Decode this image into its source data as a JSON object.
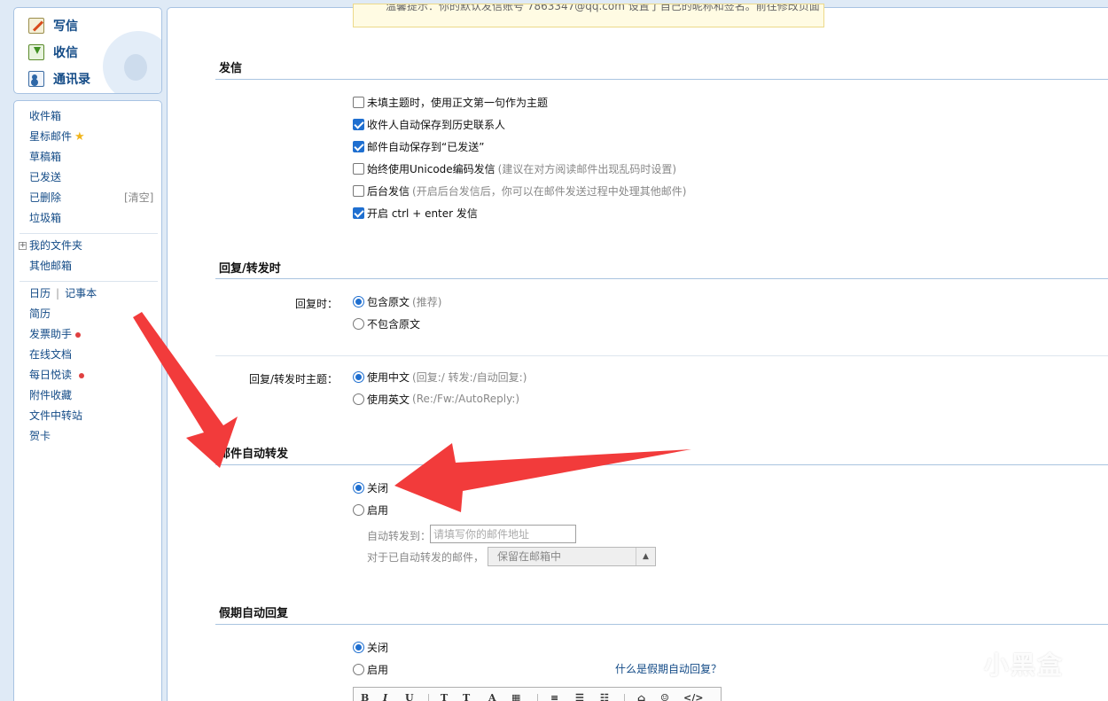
{
  "sidebar": {
    "top": [
      {
        "label": "写信",
        "icon": "compose-icon"
      },
      {
        "label": "收信",
        "icon": "inbox-download-icon"
      },
      {
        "label": "通讯录",
        "icon": "contacts-icon"
      }
    ],
    "folders": [
      "收件箱",
      "星标邮件",
      "草稿箱",
      "已发送",
      "已删除",
      "垃圾箱"
    ],
    "clear_label": "[清空]",
    "my_folders": "我的文件夹",
    "other_mailbox": "其他邮箱",
    "calendar": "日历",
    "notebook": "记事本",
    "tools": [
      "简历",
      "发票助手",
      "在线文档",
      "每日悦读",
      "附件收藏",
      "文件中转站",
      "贺卡"
    ]
  },
  "notice": "温馨提示：你的默认发信账号 7863347@qq.com 设置了自己的昵称和签名。前往修改页面",
  "send": {
    "title": "发信",
    "options": [
      {
        "label": "未填主题时，使用正文第一句作为主题",
        "hint": "",
        "checked": false
      },
      {
        "label": "收件人自动保存到历史联系人",
        "hint": "",
        "checked": true
      },
      {
        "label": "邮件自动保存到“已发送”",
        "hint": "",
        "checked": true
      },
      {
        "label": "始终使用Unicode编码发信",
        "hint": "(建议在对方阅读邮件出现乱码时设置)",
        "checked": false
      },
      {
        "label": "后台发信",
        "hint": "(开启后台发信后，你可以在邮件发送过程中处理其他邮件)",
        "checked": false
      },
      {
        "label": "开启 ctrl + enter 发信",
        "hint": "",
        "checked": true
      }
    ]
  },
  "reply": {
    "title": "回复/转发时",
    "reply_label": "回复时：",
    "reply_options": [
      {
        "label": "包含原文",
        "hint": "(推荐)",
        "selected": true
      },
      {
        "label": "不包含原文",
        "hint": "",
        "selected": false
      }
    ],
    "subject_label": "回复/转发时主题：",
    "subject_options": [
      {
        "label": "使用中文",
        "hint": "(回复:/ 转发:/自动回复:)",
        "selected": true
      },
      {
        "label": "使用英文",
        "hint": "(Re:/Fw:/AutoReply:)",
        "selected": false
      }
    ]
  },
  "forward": {
    "title": "邮件自动转发",
    "options": [
      {
        "label": "关闭",
        "selected": true
      },
      {
        "label": "启用",
        "selected": false
      }
    ],
    "forward_to_label": "自动转发到：",
    "forward_to_placeholder": "请填写你的邮件地址",
    "after_forward_label": "对于已自动转发的邮件，",
    "after_forward_value": "保留在邮箱中"
  },
  "vacation": {
    "title": "假期自动回复",
    "options": [
      {
        "label": "关闭",
        "selected": true
      },
      {
        "label": "启用",
        "selected": false
      }
    ],
    "help_link": "什么是假期自动回复？"
  },
  "editor_toolbar": [
    "B",
    "I",
    "U",
    "T",
    "T",
    "A",
    "▦",
    "≡",
    "☰",
    "☷",
    "⌂",
    "☺",
    "</>"
  ],
  "watermark": "小黑盒",
  "colors": {
    "accent": "#1f6fd0",
    "link": "#124a86",
    "arrow": "#f23b3b",
    "section_line": "#a9c4e0"
  }
}
